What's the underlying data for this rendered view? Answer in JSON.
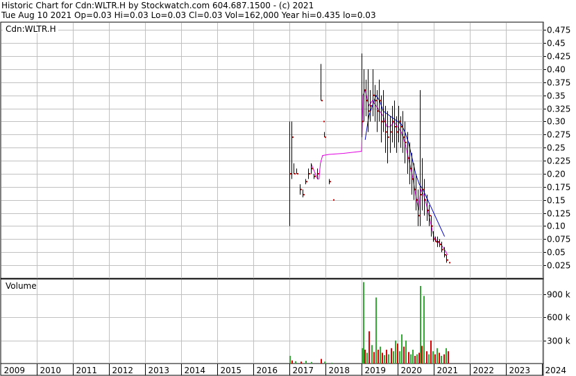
{
  "header": {
    "line1": "Historic Chart for Cdn:WLTR.H by Stockwatch.com 604.687.1500 - (c) 2021",
    "line2": "Tue Aug 10 2021  Op=0.03  Hi=0.03  Lo=0.03  Cl=0.03  Vol=162,000  Year hi=0.435  lo=0.03"
  },
  "price_panel": {
    "label": "Cdn:WLTR.H"
  },
  "volume_panel": {
    "label": "Volume"
  },
  "colors": {
    "price_bar": "#000000",
    "down_close": "#cc0000",
    "ma_short": "#e000e0",
    "ma_long": "#0000cc",
    "vol_up": "#33aa33",
    "vol_down": "#dd0000",
    "grid": "#c0c0c0"
  },
  "chart_data": [
    {
      "type": "line",
      "name_text": "Cdn:WLTR.H",
      "xlabel": "",
      "ylabel": "",
      "x_ticks": [
        "2009",
        "2010",
        "2011",
        "2012",
        "2013",
        "2014",
        "2015",
        "2016",
        "2017",
        "2018",
        "2019",
        "2020",
        "2021",
        "2022",
        "2023",
        "2024"
      ],
      "y_ticks": [
        "0.475",
        "0.45",
        "0.425",
        "0.40",
        "0.375",
        "0.35",
        "0.325",
        "0.30",
        "0.275",
        "0.25",
        "0.225",
        "0.20",
        "0.175",
        "0.15",
        "0.125",
        "0.10",
        "0.075",
        "0.05",
        "0.025"
      ],
      "ylim": [
        0.0,
        0.49
      ],
      "xlim": [
        2009.0,
        2024.0
      ],
      "grid": true,
      "ohlc": [
        {
          "t": 2017.0,
          "h": 0.3,
          "l": 0.1,
          "c": 0.2
        },
        {
          "t": 2017.05,
          "h": 0.3,
          "l": 0.19,
          "c": 0.27
        },
        {
          "t": 2017.12,
          "h": 0.22,
          "l": 0.2,
          "c": 0.2
        },
        {
          "t": 2017.2,
          "h": 0.21,
          "l": 0.2,
          "c": 0.2
        },
        {
          "t": 2017.28,
          "h": 0.18,
          "l": 0.16,
          "c": 0.17
        },
        {
          "t": 2017.36,
          "h": 0.17,
          "l": 0.155,
          "c": 0.16
        },
        {
          "t": 2017.44,
          "h": 0.19,
          "l": 0.18,
          "c": 0.185
        },
        {
          "t": 2017.52,
          "h": 0.21,
          "l": 0.19,
          "c": 0.2
        },
        {
          "t": 2017.6,
          "h": 0.22,
          "l": 0.2,
          "c": 0.21
        },
        {
          "t": 2017.68,
          "h": 0.2,
          "l": 0.19,
          "c": 0.195
        },
        {
          "t": 2017.76,
          "h": 0.21,
          "l": 0.19,
          "c": 0.2
        },
        {
          "t": 2017.86,
          "h": 0.41,
          "l": 0.34,
          "c": 0.34
        },
        {
          "t": 2017.92,
          "h": 0.3,
          "l": 0.3,
          "c": 0.3
        },
        {
          "t": 2017.96,
          "h": 0.28,
          "l": 0.27,
          "c": 0.27
        },
        {
          "t": 2018.1,
          "h": 0.19,
          "l": 0.18,
          "c": 0.185
        },
        {
          "t": 2018.2,
          "h": 0.15,
          "l": 0.15,
          "c": 0.15
        },
        {
          "t": 2019.0,
          "h": 0.43,
          "l": 0.27,
          "c": 0.3
        },
        {
          "t": 2019.06,
          "h": 0.4,
          "l": 0.3,
          "c": 0.36
        },
        {
          "t": 2019.12,
          "h": 0.38,
          "l": 0.31,
          "c": 0.34
        },
        {
          "t": 2019.18,
          "h": 0.4,
          "l": 0.28,
          "c": 0.32
        },
        {
          "t": 2019.24,
          "h": 0.36,
          "l": 0.3,
          "c": 0.33
        },
        {
          "t": 2019.3,
          "h": 0.4,
          "l": 0.31,
          "c": 0.35
        },
        {
          "t": 2019.36,
          "h": 0.37,
          "l": 0.3,
          "c": 0.34
        },
        {
          "t": 2019.42,
          "h": 0.36,
          "l": 0.28,
          "c": 0.32
        },
        {
          "t": 2019.48,
          "h": 0.38,
          "l": 0.3,
          "c": 0.34
        },
        {
          "t": 2019.54,
          "h": 0.35,
          "l": 0.26,
          "c": 0.3
        },
        {
          "t": 2019.6,
          "h": 0.36,
          "l": 0.28,
          "c": 0.3
        },
        {
          "t": 2019.66,
          "h": 0.33,
          "l": 0.24,
          "c": 0.28
        },
        {
          "t": 2019.72,
          "h": 0.32,
          "l": 0.22,
          "c": 0.27
        },
        {
          "t": 2019.78,
          "h": 0.31,
          "l": 0.24,
          "c": 0.28
        },
        {
          "t": 2019.84,
          "h": 0.33,
          "l": 0.26,
          "c": 0.3
        },
        {
          "t": 2019.9,
          "h": 0.34,
          "l": 0.25,
          "c": 0.29
        },
        {
          "t": 2019.96,
          "h": 0.31,
          "l": 0.24,
          "c": 0.28
        },
        {
          "t": 2020.02,
          "h": 0.33,
          "l": 0.26,
          "c": 0.3
        },
        {
          "t": 2020.08,
          "h": 0.31,
          "l": 0.25,
          "c": 0.29
        },
        {
          "t": 2020.14,
          "h": 0.32,
          "l": 0.24,
          "c": 0.27
        },
        {
          "t": 2020.2,
          "h": 0.3,
          "l": 0.22,
          "c": 0.26
        },
        {
          "t": 2020.26,
          "h": 0.28,
          "l": 0.2,
          "c": 0.23
        },
        {
          "t": 2020.32,
          "h": 0.26,
          "l": 0.18,
          "c": 0.21
        },
        {
          "t": 2020.38,
          "h": 0.24,
          "l": 0.16,
          "c": 0.19
        },
        {
          "t": 2020.44,
          "h": 0.22,
          "l": 0.15,
          "c": 0.17
        },
        {
          "t": 2020.5,
          "h": 0.2,
          "l": 0.13,
          "c": 0.15
        },
        {
          "t": 2020.56,
          "h": 0.17,
          "l": 0.1,
          "c": 0.12
        },
        {
          "t": 2020.62,
          "h": 0.36,
          "l": 0.1,
          "c": 0.16
        },
        {
          "t": 2020.68,
          "h": 0.23,
          "l": 0.13,
          "c": 0.17
        },
        {
          "t": 2020.74,
          "h": 0.19,
          "l": 0.12,
          "c": 0.15
        },
        {
          "t": 2020.8,
          "h": 0.16,
          "l": 0.11,
          "c": 0.13
        },
        {
          "t": 2020.86,
          "h": 0.14,
          "l": 0.1,
          "c": 0.12
        },
        {
          "t": 2020.92,
          "h": 0.12,
          "l": 0.08,
          "c": 0.1
        },
        {
          "t": 2020.98,
          "h": 0.09,
          "l": 0.07,
          "c": 0.075
        },
        {
          "t": 2021.04,
          "h": 0.08,
          "l": 0.07,
          "c": 0.07
        },
        {
          "t": 2021.1,
          "h": 0.08,
          "l": 0.06,
          "c": 0.07
        },
        {
          "t": 2021.16,
          "h": 0.075,
          "l": 0.06,
          "c": 0.065
        },
        {
          "t": 2021.22,
          "h": 0.07,
          "l": 0.05,
          "c": 0.055
        },
        {
          "t": 2021.28,
          "h": 0.06,
          "l": 0.04,
          "c": 0.045
        },
        {
          "t": 2021.34,
          "h": 0.045,
          "l": 0.03,
          "c": 0.035
        },
        {
          "t": 2021.4,
          "h": 0.03,
          "l": 0.03,
          "c": 0.03
        }
      ],
      "ma_short": [
        {
          "t": 2017.6,
          "v": 0.22
        },
        {
          "t": 2017.66,
          "v": 0.21
        },
        {
          "t": 2017.72,
          "v": 0.2
        },
        {
          "t": 2017.78,
          "v": 0.19
        },
        {
          "t": 2017.82,
          "v": 0.19
        },
        {
          "t": 2017.86,
          "v": 0.22
        },
        {
          "t": 2017.92,
          "v": 0.235
        },
        {
          "t": 2018.1,
          "v": 0.237
        },
        {
          "t": 2018.5,
          "v": 0.239
        },
        {
          "t": 2019.0,
          "v": 0.243
        },
        {
          "t": 2019.04,
          "v": 0.35
        },
        {
          "t": 2019.1,
          "v": 0.36
        },
        {
          "t": 2019.2,
          "v": 0.33
        },
        {
          "t": 2019.3,
          "v": 0.34
        },
        {
          "t": 2019.4,
          "v": 0.33
        },
        {
          "t": 2019.5,
          "v": 0.32
        },
        {
          "t": 2019.6,
          "v": 0.31
        },
        {
          "t": 2019.7,
          "v": 0.29
        },
        {
          "t": 2019.8,
          "v": 0.29
        },
        {
          "t": 2019.9,
          "v": 0.3
        },
        {
          "t": 2020.0,
          "v": 0.29
        },
        {
          "t": 2020.1,
          "v": 0.28
        },
        {
          "t": 2020.2,
          "v": 0.26
        },
        {
          "t": 2020.3,
          "v": 0.23
        },
        {
          "t": 2020.4,
          "v": 0.2
        },
        {
          "t": 2020.5,
          "v": 0.16
        },
        {
          "t": 2020.58,
          "v": 0.13
        },
        {
          "t": 2020.64,
          "v": 0.17
        },
        {
          "t": 2020.72,
          "v": 0.16
        },
        {
          "t": 2020.8,
          "v": 0.14
        },
        {
          "t": 2020.9,
          "v": 0.11
        },
        {
          "t": 2021.0,
          "v": 0.08
        },
        {
          "t": 2021.1,
          "v": 0.07
        },
        {
          "t": 2021.2,
          "v": 0.065
        },
        {
          "t": 2021.3,
          "v": 0.055
        },
        {
          "t": 2021.38,
          "v": 0.045
        }
      ],
      "ma_long": [
        {
          "t": 2019.1,
          "v": 0.265
        },
        {
          "t": 2019.2,
          "v": 0.31
        },
        {
          "t": 2019.3,
          "v": 0.33
        },
        {
          "t": 2019.4,
          "v": 0.35
        },
        {
          "t": 2019.5,
          "v": 0.34
        },
        {
          "t": 2019.6,
          "v": 0.32
        },
        {
          "t": 2019.7,
          "v": 0.315
        },
        {
          "t": 2019.8,
          "v": 0.31
        },
        {
          "t": 2019.9,
          "v": 0.305
        },
        {
          "t": 2020.0,
          "v": 0.3
        },
        {
          "t": 2020.1,
          "v": 0.295
        },
        {
          "t": 2020.2,
          "v": 0.28
        },
        {
          "t": 2020.3,
          "v": 0.26
        },
        {
          "t": 2020.4,
          "v": 0.23
        },
        {
          "t": 2020.5,
          "v": 0.2
        },
        {
          "t": 2020.6,
          "v": 0.18
        },
        {
          "t": 2020.7,
          "v": 0.17
        },
        {
          "t": 2020.8,
          "v": 0.155
        },
        {
          "t": 2020.9,
          "v": 0.14
        },
        {
          "t": 2021.0,
          "v": 0.125
        },
        {
          "t": 2021.1,
          "v": 0.11
        },
        {
          "t": 2021.2,
          "v": 0.095
        },
        {
          "t": 2021.3,
          "v": 0.08
        }
      ]
    },
    {
      "type": "bar",
      "name_text": "Volume",
      "y_ticks": [
        "900 k",
        "600 k",
        "300 k"
      ],
      "ylim": [
        0,
        1100000
      ],
      "bars": [
        {
          "t": 2017.0,
          "v": 100000,
          "dir": "up"
        },
        {
          "t": 2017.05,
          "v": 40000,
          "dir": "down"
        },
        {
          "t": 2017.15,
          "v": 30000,
          "dir": "up"
        },
        {
          "t": 2017.3,
          "v": 25000,
          "dir": "down"
        },
        {
          "t": 2017.45,
          "v": 35000,
          "dir": "up"
        },
        {
          "t": 2017.6,
          "v": 20000,
          "dir": "up"
        },
        {
          "t": 2017.86,
          "v": 60000,
          "dir": "down"
        },
        {
          "t": 2017.96,
          "v": 25000,
          "dir": "up"
        },
        {
          "t": 2018.15,
          "v": 10000,
          "dir": "up"
        },
        {
          "t": 2019.0,
          "v": 200000,
          "dir": "up"
        },
        {
          "t": 2019.03,
          "v": 1060000,
          "dir": "up"
        },
        {
          "t": 2019.08,
          "v": 180000,
          "dir": "down"
        },
        {
          "t": 2019.14,
          "v": 140000,
          "dir": "up"
        },
        {
          "t": 2019.2,
          "v": 420000,
          "dir": "down"
        },
        {
          "t": 2019.26,
          "v": 240000,
          "dir": "up"
        },
        {
          "t": 2019.32,
          "v": 150000,
          "dir": "down"
        },
        {
          "t": 2019.38,
          "v": 860000,
          "dir": "up"
        },
        {
          "t": 2019.44,
          "v": 180000,
          "dir": "down"
        },
        {
          "t": 2019.5,
          "v": 220000,
          "dir": "up"
        },
        {
          "t": 2019.56,
          "v": 140000,
          "dir": "down"
        },
        {
          "t": 2019.62,
          "v": 110000,
          "dir": "up"
        },
        {
          "t": 2019.68,
          "v": 180000,
          "dir": "down"
        },
        {
          "t": 2019.74,
          "v": 120000,
          "dir": "up"
        },
        {
          "t": 2019.8,
          "v": 200000,
          "dir": "down"
        },
        {
          "t": 2019.86,
          "v": 160000,
          "dir": "up"
        },
        {
          "t": 2019.92,
          "v": 300000,
          "dir": "up"
        },
        {
          "t": 2019.98,
          "v": 260000,
          "dir": "down"
        },
        {
          "t": 2020.04,
          "v": 160000,
          "dir": "up"
        },
        {
          "t": 2020.1,
          "v": 380000,
          "dir": "up"
        },
        {
          "t": 2020.16,
          "v": 220000,
          "dir": "down"
        },
        {
          "t": 2020.22,
          "v": 300000,
          "dir": "up"
        },
        {
          "t": 2020.28,
          "v": 150000,
          "dir": "down"
        },
        {
          "t": 2020.34,
          "v": 120000,
          "dir": "up"
        },
        {
          "t": 2020.4,
          "v": 180000,
          "dir": "up"
        },
        {
          "t": 2020.46,
          "v": 100000,
          "dir": "down"
        },
        {
          "t": 2020.52,
          "v": 120000,
          "dir": "up"
        },
        {
          "t": 2020.58,
          "v": 140000,
          "dir": "down"
        },
        {
          "t": 2020.62,
          "v": 1010000,
          "dir": "up"
        },
        {
          "t": 2020.66,
          "v": 230000,
          "dir": "down"
        },
        {
          "t": 2020.72,
          "v": 880000,
          "dir": "up"
        },
        {
          "t": 2020.78,
          "v": 160000,
          "dir": "down"
        },
        {
          "t": 2020.84,
          "v": 120000,
          "dir": "up"
        },
        {
          "t": 2020.9,
          "v": 300000,
          "dir": "down"
        },
        {
          "t": 2020.96,
          "v": 160000,
          "dir": "up"
        },
        {
          "t": 2021.02,
          "v": 120000,
          "dir": "down"
        },
        {
          "t": 2021.08,
          "v": 200000,
          "dir": "up"
        },
        {
          "t": 2021.14,
          "v": 140000,
          "dir": "down"
        },
        {
          "t": 2021.2,
          "v": 100000,
          "dir": "up"
        },
        {
          "t": 2021.26,
          "v": 120000,
          "dir": "down"
        },
        {
          "t": 2021.32,
          "v": 200000,
          "dir": "up"
        },
        {
          "t": 2021.38,
          "v": 160000,
          "dir": "down"
        }
      ]
    }
  ]
}
